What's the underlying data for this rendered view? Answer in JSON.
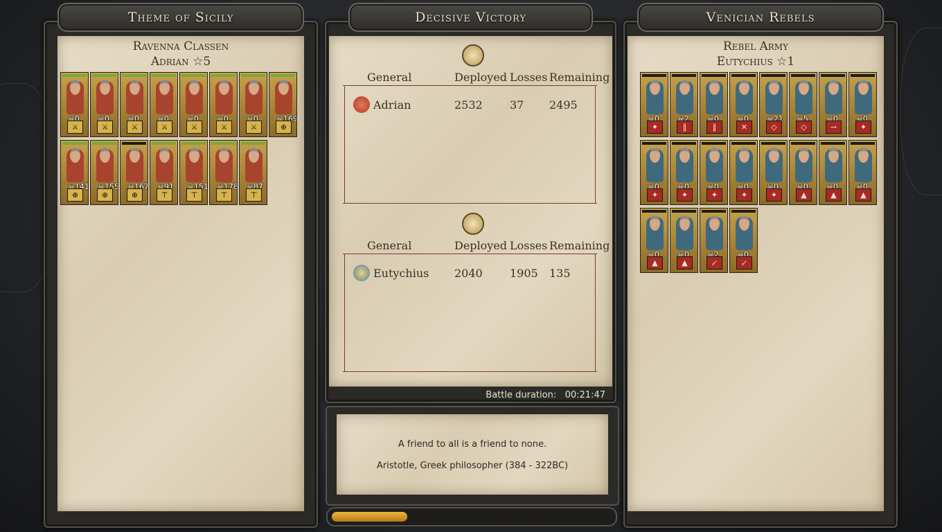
{
  "left": {
    "title": "Theme of Sicily",
    "army_name": "Ravenna Classen",
    "general": "Adrian",
    "general_rank": "5",
    "units": [
      {
        "count": "0",
        "symbol": "⚔",
        "hp": "green"
      },
      {
        "count": "0",
        "symbol": "⚔",
        "hp": "green"
      },
      {
        "count": "0",
        "symbol": "⚔",
        "hp": "green"
      },
      {
        "count": "0",
        "symbol": "⚔",
        "hp": "green"
      },
      {
        "count": "0",
        "symbol": "⚔",
        "hp": "green"
      },
      {
        "count": "0",
        "symbol": "⚔",
        "hp": "green"
      },
      {
        "count": "0",
        "symbol": "⚔",
        "hp": "green"
      },
      {
        "count": "169",
        "symbol": "⊕",
        "hp": "green"
      },
      {
        "count": "141",
        "symbol": "⊕",
        "hp": "green"
      },
      {
        "count": "155",
        "symbol": "⊕",
        "hp": "green"
      },
      {
        "count": "167",
        "symbol": "⊕",
        "hp": "dark"
      },
      {
        "count": "91",
        "symbol": "⊤",
        "hp": "green"
      },
      {
        "count": "151",
        "symbol": "⊤",
        "hp": "green"
      },
      {
        "count": "178",
        "symbol": "⊤",
        "hp": "green"
      },
      {
        "count": "87",
        "symbol": "⊤",
        "hp": "green"
      }
    ]
  },
  "center": {
    "title": "Decisive Victory",
    "headers": {
      "general": "General",
      "deployed": "Deployed",
      "losses": "Losses",
      "remaining": "Remaining"
    },
    "side1": {
      "general": "Adrian",
      "deployed": "2532",
      "losses": "37",
      "remaining": "2495"
    },
    "side2": {
      "general": "Eutychius",
      "deployed": "2040",
      "losses": "1905",
      "remaining": "135"
    },
    "duration_label": "Battle duration:",
    "duration_value": "00:21:47",
    "quote": "A friend to all is a friend to none.",
    "quote_author": "Aristotle, Greek philosopher (384 - 322BC)",
    "progress": 0.27
  },
  "right": {
    "title": "Venician Rebels",
    "army_name": "Rebel Army",
    "general": "Eutychius",
    "general_rank": "1",
    "units": [
      {
        "count": "0",
        "symbol": "✦"
      },
      {
        "count": "2",
        "symbol": "‖"
      },
      {
        "count": "0",
        "symbol": "‖"
      },
      {
        "count": "0",
        "symbol": "✕"
      },
      {
        "count": "21",
        "symbol": "◇"
      },
      {
        "count": "5",
        "symbol": "◇"
      },
      {
        "count": "0",
        "symbol": "→"
      },
      {
        "count": "0",
        "symbol": "✦"
      },
      {
        "count": "0",
        "symbol": "✦"
      },
      {
        "count": "0",
        "symbol": "✦"
      },
      {
        "count": "0",
        "symbol": "✦"
      },
      {
        "count": "0",
        "symbol": "✦"
      },
      {
        "count": "0",
        "symbol": "✦"
      },
      {
        "count": "0",
        "symbol": "▲"
      },
      {
        "count": "0",
        "symbol": "▲"
      },
      {
        "count": "0",
        "symbol": "▲"
      },
      {
        "count": "0",
        "symbol": "▲"
      },
      {
        "count": "0",
        "symbol": "▲"
      },
      {
        "count": "2",
        "symbol": "↙"
      },
      {
        "count": "0",
        "symbol": "↙"
      }
    ]
  },
  "colors": {
    "parchment": "#ddd1b8",
    "red_accent": "#7a3a2e",
    "gold": "#c6a24a",
    "left_unit": "#a8442e",
    "right_unit": "#3f6a7e"
  }
}
